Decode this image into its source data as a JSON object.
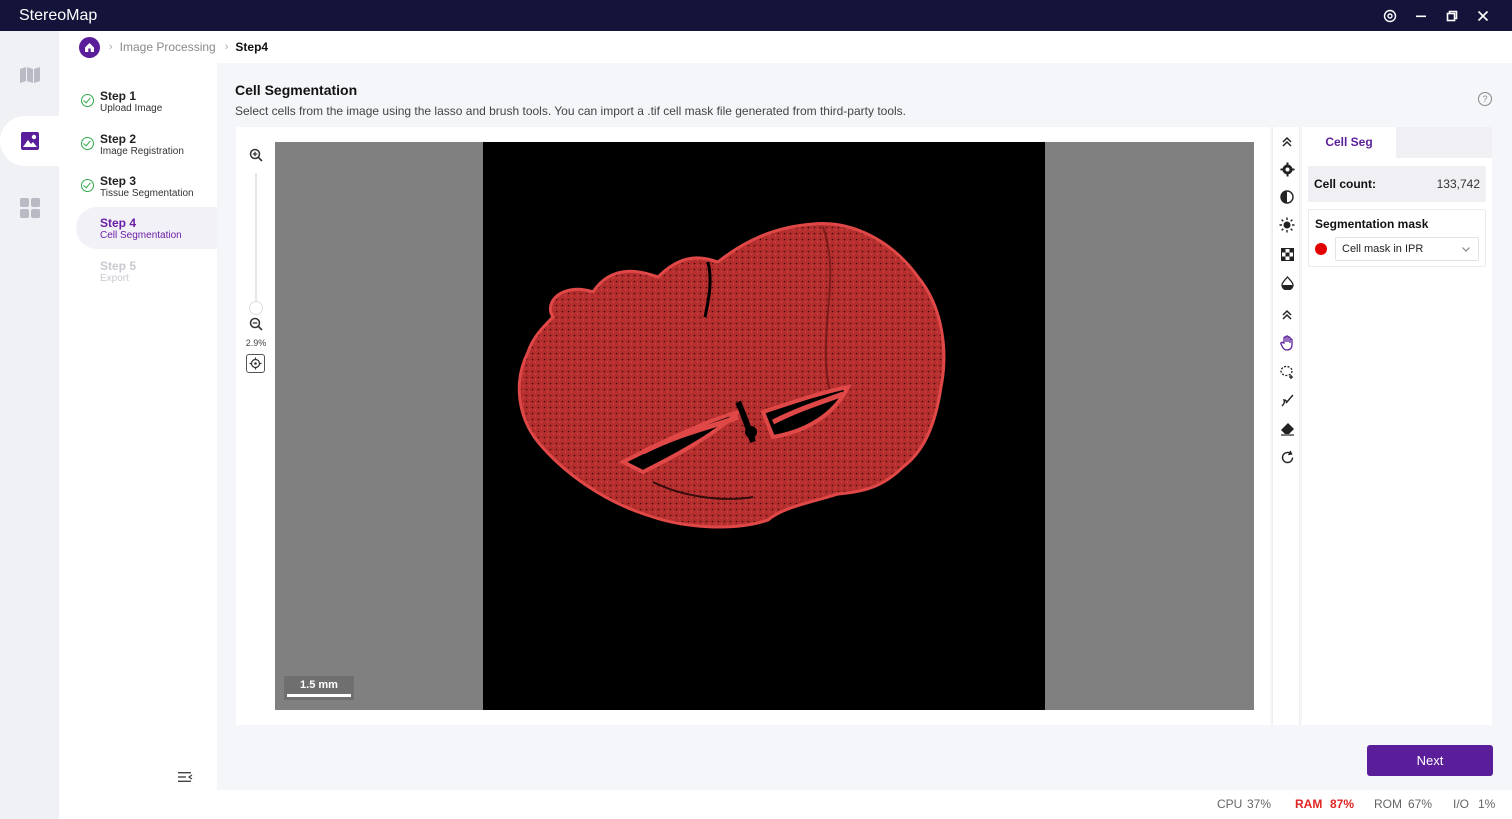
{
  "app": {
    "title": "StereoMap"
  },
  "breadcrumb": {
    "items": [
      "Image Processing",
      "Step4"
    ]
  },
  "steps": [
    {
      "title": "Step 1",
      "subtitle": "Upload Image",
      "state": "done"
    },
    {
      "title": "Step 2",
      "subtitle": "Image Registration",
      "state": "done"
    },
    {
      "title": "Step 3",
      "subtitle": "Tissue Segmentation",
      "state": "done"
    },
    {
      "title": "Step 4",
      "subtitle": "Cell Segmentation",
      "state": "active"
    },
    {
      "title": "Step 5",
      "subtitle": "Export",
      "state": "disabled"
    }
  ],
  "main": {
    "title": "Cell Segmentation",
    "description": "Select cells from the image using the lasso and brush tools. You can import a .tif cell mask file generated from third-party tools."
  },
  "viewer": {
    "zoom_label": "2.9%",
    "scale_bar": "1.5 mm"
  },
  "tools": [
    "collapse-up-icon",
    "settings-icon",
    "contrast-icon",
    "brightness-icon",
    "checker-icon",
    "opacity-icon",
    "collapse-up-icon",
    "hand-icon",
    "lasso-icon",
    "brush-icon",
    "eraser-icon",
    "redo-icon"
  ],
  "right_panel": {
    "tab": "Cell Seg",
    "cell_count_label": "Cell count:",
    "cell_count_value": "133,742",
    "seg_mask_title": "Segmentation mask",
    "seg_mask_value": "Cell mask in IPR",
    "seg_mask_color": "#e30000"
  },
  "actions": {
    "next_label": "Next"
  },
  "status": {
    "cpu_label": "CPU",
    "cpu_value": "37%",
    "ram_label": "RAM",
    "ram_value": "87%",
    "rom_label": "ROM",
    "rom_value": "67%",
    "io_label": "I/O",
    "io_value": "1%"
  },
  "colors": {
    "accent": "#5b1e9a",
    "titlebar": "#14143a",
    "tissue": "#d23a3a",
    "success": "#2fa84a",
    "warning": "#e02424"
  }
}
